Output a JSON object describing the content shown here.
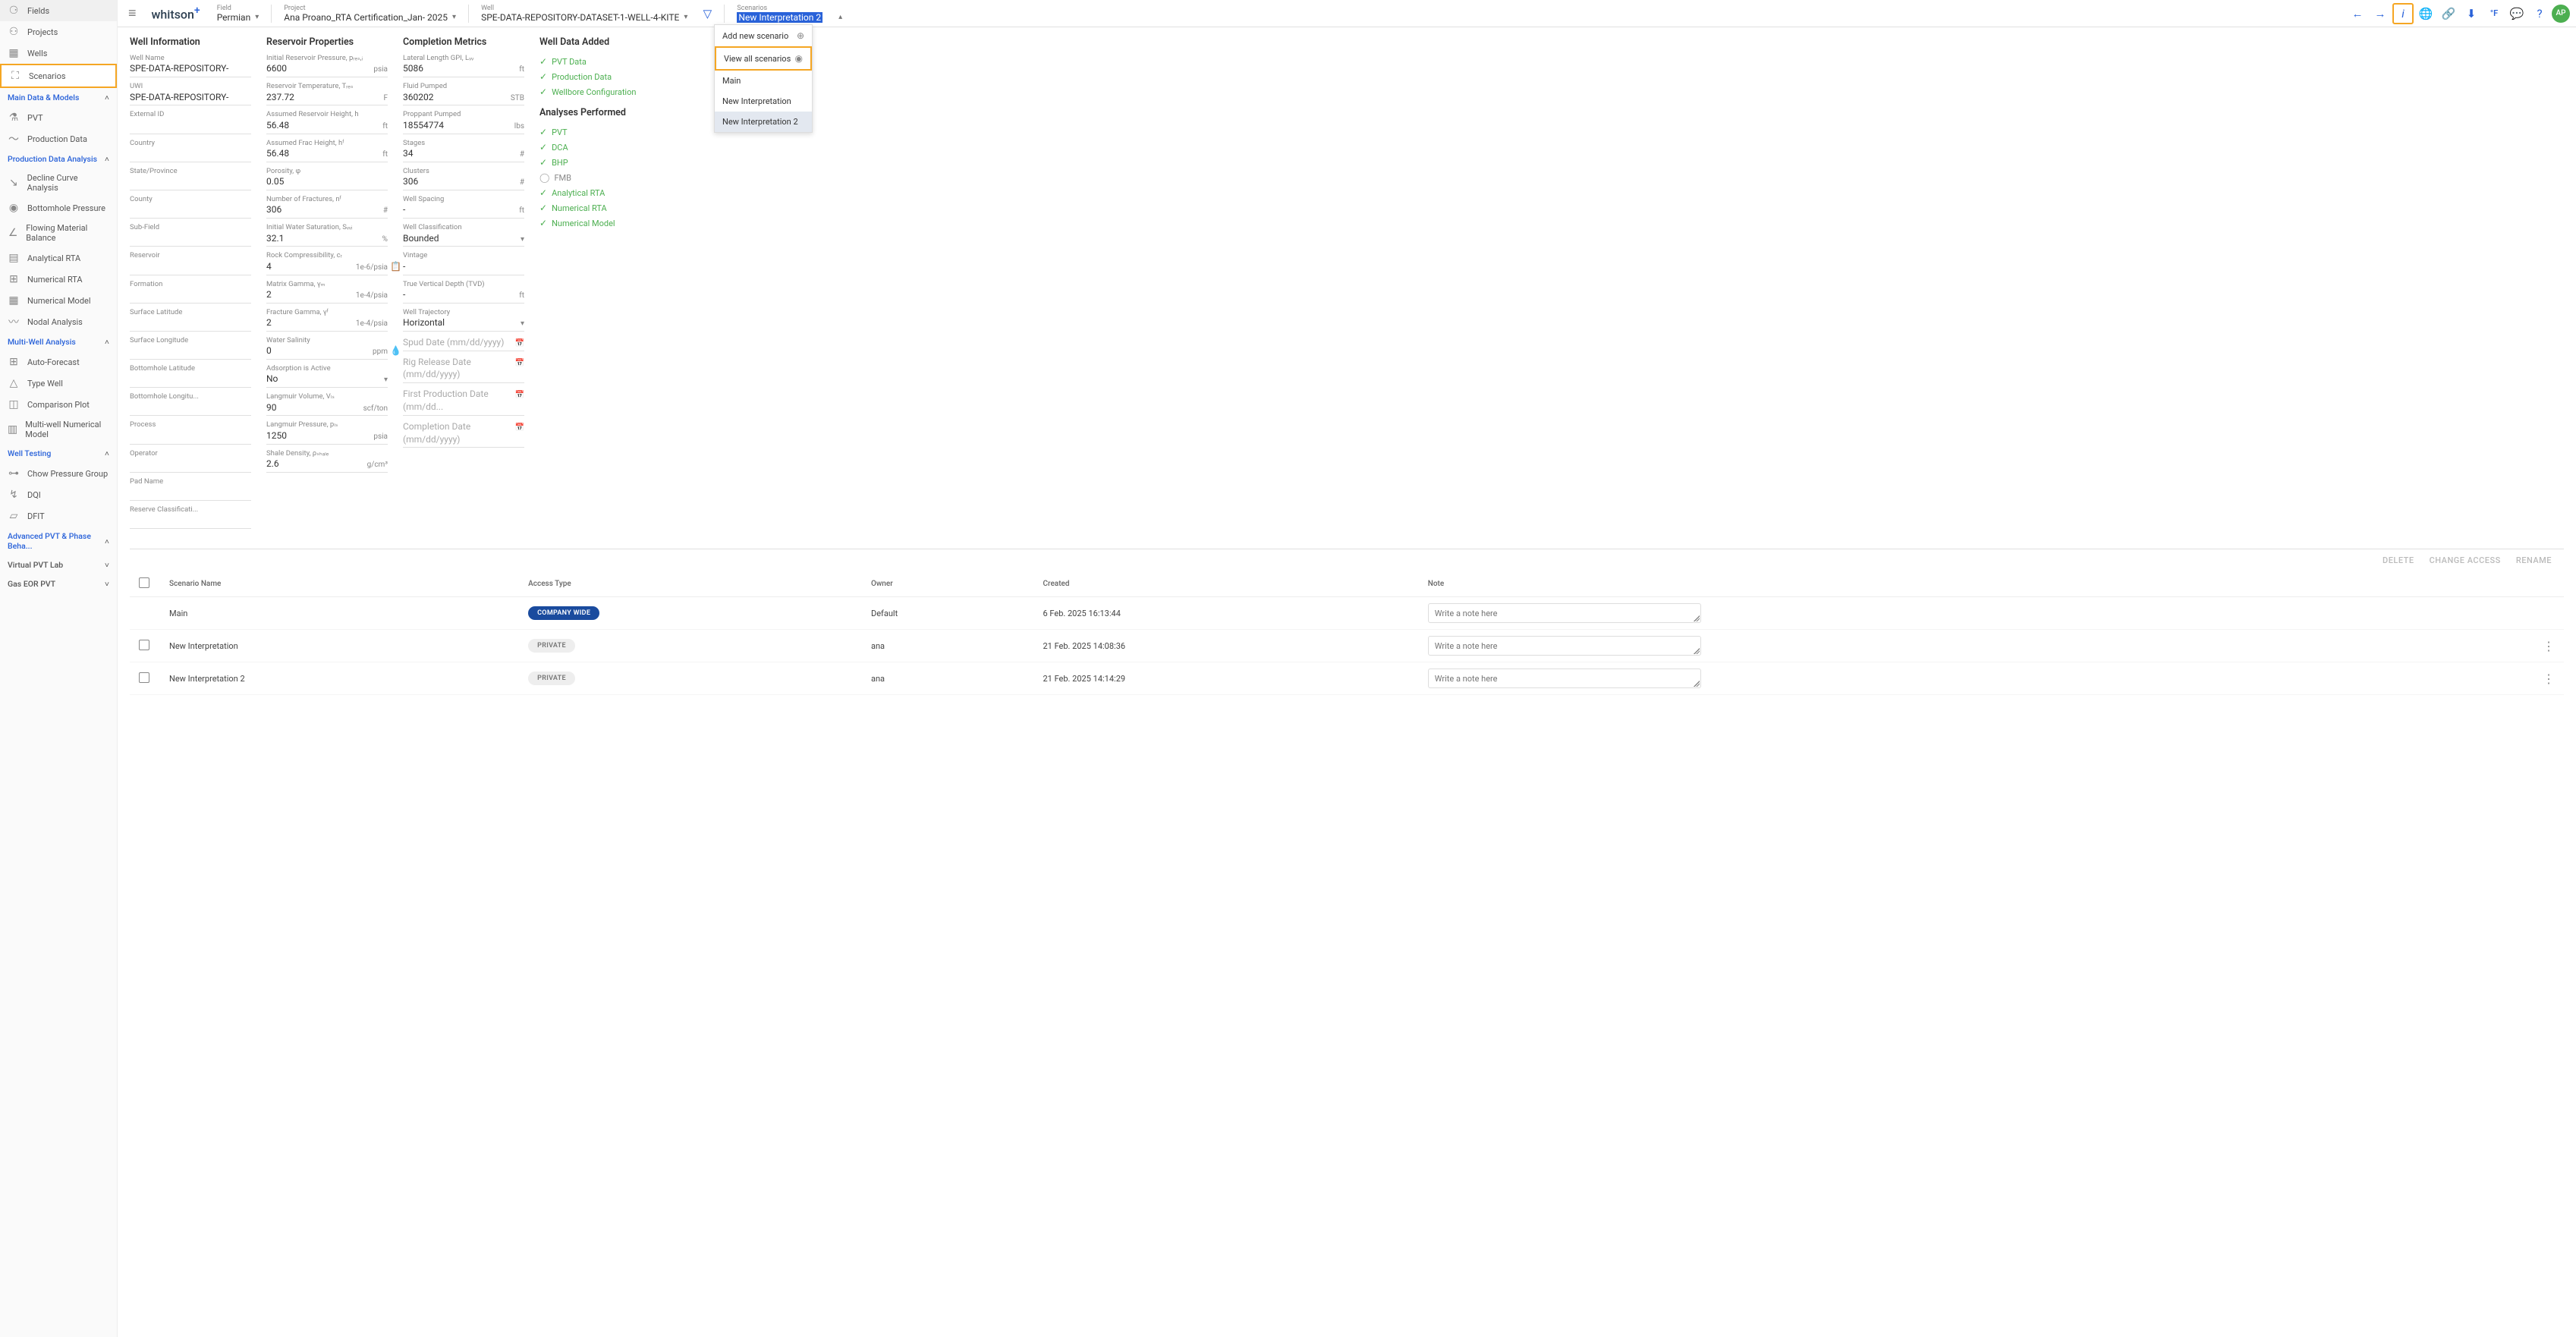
{
  "sidebar": {
    "top": [
      {
        "icon": "⚬⚬",
        "label": "Fields"
      },
      {
        "icon": "⚬⚬",
        "label": "Projects"
      },
      {
        "icon": "▦",
        "label": "Wells"
      },
      {
        "icon": "⛶",
        "label": "Scenarios"
      }
    ],
    "sections": [
      {
        "title": "Main Data & Models",
        "items": [
          {
            "icon": "⚗",
            "label": "PVT"
          },
          {
            "icon": "〜",
            "label": "Production Data"
          }
        ]
      },
      {
        "title": "Production Data Analysis",
        "items": [
          {
            "icon": "↘",
            "label": "Decline Curve Analysis"
          },
          {
            "icon": "◉",
            "label": "Bottomhole Pressure"
          },
          {
            "icon": "∠",
            "label": "Flowing Material Balance"
          },
          {
            "icon": "▤",
            "label": "Analytical RTA"
          },
          {
            "icon": "⊞",
            "label": "Numerical RTA"
          },
          {
            "icon": "▦",
            "label": "Numerical Model"
          },
          {
            "icon": "〰",
            "label": "Nodal Analysis"
          }
        ]
      },
      {
        "title": "Multi-Well Analysis",
        "items": [
          {
            "icon": "⊞",
            "label": "Auto-Forecast"
          },
          {
            "icon": "△",
            "label": "Type Well"
          },
          {
            "icon": "◫",
            "label": "Comparison Plot"
          },
          {
            "icon": "▥",
            "label": "Multi-well Numerical Model"
          }
        ]
      },
      {
        "title": "Well Testing",
        "items": [
          {
            "icon": "⊶",
            "label": "Chow Pressure Group"
          },
          {
            "icon": "↯",
            "label": "DQI"
          },
          {
            "icon": "▱",
            "label": "DFIT"
          }
        ]
      },
      {
        "title": "Advanced PVT & Phase Beha...",
        "collapsed": true
      },
      {
        "title2": "Virtual PVT Lab",
        "collapsed": true
      },
      {
        "title2": "Gas EOR PVT",
        "collapsed": true
      }
    ]
  },
  "topbar": {
    "logo": "whitson",
    "crumbs": [
      {
        "label": "Field",
        "value": "Permian"
      },
      {
        "label": "Project",
        "value": "Ana Proano_RTA Certification_Jan- 2025"
      },
      {
        "label": "Well",
        "value": "SPE-DATA-REPOSITORY-DATASET-1-WELL-4-KITE"
      },
      {
        "label": "Scenarios",
        "value": "New Interpretation 2",
        "selected": true
      }
    ],
    "avatar": "AP"
  },
  "dropdown": {
    "add": "Add new scenario",
    "view": "View all scenarios",
    "items": [
      "Main",
      "New Interpretation",
      "New Interpretation 2"
    ]
  },
  "wellInfo": {
    "title": "Well Information",
    "fields": [
      {
        "label": "Well Name",
        "value": "SPE-DATA-REPOSITORY-"
      },
      {
        "label": "UWI",
        "value": "SPE-DATA-REPOSITORY-"
      },
      {
        "label": "External ID",
        "value": ""
      },
      {
        "label": "Country",
        "value": ""
      },
      {
        "label": "State/Province",
        "value": ""
      },
      {
        "label": "County",
        "value": ""
      },
      {
        "label": "Sub-Field",
        "value": ""
      },
      {
        "label": "Reservoir",
        "value": ""
      },
      {
        "label": "Formation",
        "value": ""
      },
      {
        "label": "Surface Latitude",
        "value": ""
      },
      {
        "label": "Surface Longitude",
        "value": ""
      },
      {
        "label": "Bottomhole Latitude",
        "value": ""
      },
      {
        "label": "Bottomhole Longitu...",
        "value": ""
      },
      {
        "label": "Process",
        "value": ""
      },
      {
        "label": "Operator",
        "value": ""
      },
      {
        "label": "Pad Name",
        "value": ""
      },
      {
        "label": "Reserve Classificati...",
        "value": ""
      }
    ]
  },
  "resProps": {
    "title": "Reservoir Properties",
    "fields": [
      {
        "label": "Initial Reservoir Pressure, pᵣₑₛ,ᵢ",
        "value": "6600",
        "unit": "psia"
      },
      {
        "label": "Reservoir Temperature, Tᵣₑₛ",
        "value": "237.72",
        "unit": "F"
      },
      {
        "label": "Assumed Reservoir Height, h",
        "value": "56.48",
        "unit": "ft"
      },
      {
        "label": "Assumed Frac Height, hᶠ",
        "value": "56.48",
        "unit": "ft"
      },
      {
        "label": "Porosity, φ",
        "value": "0.05",
        "unit": ""
      },
      {
        "label": "Number of Fractures, nᶠ",
        "value": "306",
        "unit": "#"
      },
      {
        "label": "Initial Water Saturation, Sᵥᵥᵢ",
        "value": "32.1",
        "unit": "%"
      },
      {
        "label": "Rock Compressibility, cᵣ",
        "value": "4",
        "unit": "1e-6/psia",
        "icon": "📋"
      },
      {
        "label": "Matrix Gamma, γₘ",
        "value": "2",
        "unit": "1e-4/psia"
      },
      {
        "label": "Fracture Gamma, γᶠ",
        "value": "2",
        "unit": "1e-4/psia"
      },
      {
        "label": "Water Salinity",
        "value": "0",
        "unit": "ppm",
        "icon": "💧"
      },
      {
        "label": "Adsorption is Active",
        "value": "No",
        "unit": "▾"
      },
      {
        "label": "Langmuir Volume, Vₗₛ",
        "value": "90",
        "unit": "scf/ton"
      },
      {
        "label": "Langmuir Pressure, pₗₛ",
        "value": "1250",
        "unit": "psia"
      },
      {
        "label": "Shale Density, ρₛₕₐₗₑ",
        "value": "2.6",
        "unit": "g/cm³"
      }
    ]
  },
  "compMetrics": {
    "title": "Completion Metrics",
    "fields": [
      {
        "label": "Lateral Length GPI, Lᵥᵥ",
        "value": "5086",
        "unit": "ft"
      },
      {
        "label": "Fluid Pumped",
        "value": "360202",
        "unit": "STB"
      },
      {
        "label": "Proppant Pumped",
        "value": "18554774",
        "unit": "lbs"
      },
      {
        "label": "Stages",
        "value": "34",
        "unit": "#"
      },
      {
        "label": "Clusters",
        "value": "306",
        "unit": "#"
      },
      {
        "label": "Well Spacing",
        "value": "-",
        "unit": "ft"
      },
      {
        "label": "Well Classification",
        "value": "Bounded",
        "unit": "▾"
      },
      {
        "label": "Vintage",
        "value": "-",
        "unit": ""
      },
      {
        "label": "True Vertical Depth (TVD)",
        "value": "-",
        "unit": "ft"
      },
      {
        "label": "Well Trajectory",
        "value": "Horizontal",
        "unit": "▾"
      }
    ],
    "dates": [
      {
        "ph": "Spud Date (mm/dd/yyyy)"
      },
      {
        "ph": "Rig Release Date (mm/dd/yyyy)"
      },
      {
        "ph": "First Production Date (mm/dd..."
      },
      {
        "ph": "Completion Date (mm/dd/yyyy)"
      }
    ]
  },
  "wellData": {
    "title": "Well Data Added",
    "items": [
      "PVT Data",
      "Production Data",
      "Wellbore Configuration"
    ]
  },
  "analyses": {
    "title": "Analyses Performed",
    "items": [
      {
        "label": "PVT",
        "done": true
      },
      {
        "label": "DCA",
        "done": true
      },
      {
        "label": "BHP",
        "done": true
      },
      {
        "label": "FMB",
        "done": false
      },
      {
        "label": "Analytical RTA",
        "done": true
      },
      {
        "label": "Numerical RTA",
        "done": true
      },
      {
        "label": "Numerical Model",
        "done": true
      }
    ]
  },
  "table": {
    "actions": [
      "DELETE",
      "CHANGE ACCESS",
      "RENAME"
    ],
    "headers": [
      "",
      "Scenario Name",
      "Access Type",
      "Owner",
      "Created",
      "Note",
      ""
    ],
    "rows": [
      {
        "chk": false,
        "nochk": true,
        "name": "Main",
        "access": "COMPANY WIDE",
        "accessCls": "company",
        "owner": "Default",
        "created": "6 Feb. 2025 16:13:44",
        "note": "Write a note here"
      },
      {
        "chk": false,
        "name": "New Interpretation",
        "access": "PRIVATE",
        "accessCls": "private",
        "owner": "ana",
        "created": "21 Feb. 2025 14:08:36",
        "note": "Write a note here"
      },
      {
        "chk": false,
        "name": "New Interpretation 2",
        "access": "PRIVATE",
        "accessCls": "private",
        "owner": "ana",
        "created": "21 Feb. 2025 14:14:29",
        "note": "Write a note here"
      }
    ]
  }
}
